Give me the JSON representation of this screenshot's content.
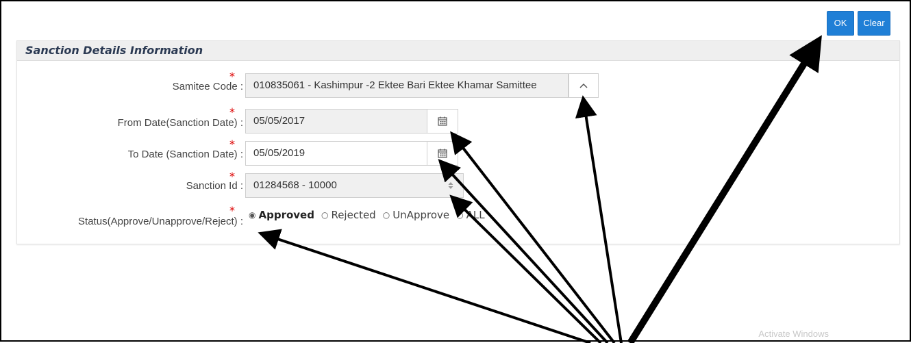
{
  "toolbar": {
    "ok_label": "OK",
    "clear_label": "Clear"
  },
  "panel": {
    "title": "Sanction Details Information"
  },
  "form": {
    "samitee_code": {
      "label": "Samitee Code :",
      "value": "010835061 - Kashimpur -2 Ektee Bari Ektee Khamar Samittee",
      "icon": "chevron-up-icon"
    },
    "from_date": {
      "label": "From Date(Sanction Date) :",
      "value": "05/05/2017",
      "icon": "calendar-icon"
    },
    "to_date": {
      "label": "To Date (Sanction Date) :",
      "value": "05/05/2019",
      "icon": "calendar-icon"
    },
    "sanction_id": {
      "label": "Sanction Id :",
      "value": "01284568 - 10000",
      "icon": "spinner-icon"
    },
    "status": {
      "label": "Status(Approve/Unapprove/Reject) :",
      "options": [
        "Approved",
        "Rejected",
        "UnApprove",
        "ALL"
      ],
      "selected": "Approved"
    },
    "required_marker": "*"
  },
  "watermark": "Activate Windows",
  "colors": {
    "button": "#1f7fd6",
    "required": "#dd0000",
    "header_text": "#2b3a53"
  }
}
